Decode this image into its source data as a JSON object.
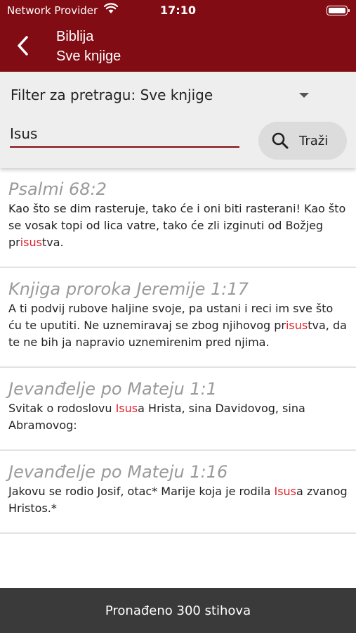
{
  "status_bar": {
    "carrier": "Network Provider",
    "time": "17:10"
  },
  "header": {
    "title": "Biblija",
    "subtitle": "Sve knjige"
  },
  "search": {
    "filter_label": "Filter za pretragu: Sve knjige",
    "query": "Isus",
    "button_label": "Traži"
  },
  "results": [
    {
      "reference": "Psalmi 68:2",
      "pre": "Kao što se dim rasteruje, tako će i oni biti rasterani! Kao što se vosak topi od lica vatre, tako će zli izginuti od Božjeg pr",
      "match": "isus",
      "post": "tva."
    },
    {
      "reference": "Knjiga proroka Jeremije 1:17",
      "pre": "A ti podvij rubove haljine svoje, pa ustani i reci im sve što ću te uputiti. Ne uznemiravaj se zbog njihovog pr",
      "match": "isus",
      "post": "tva, da te ne bih ja napravio uznemirenim pred njima."
    },
    {
      "reference": "Jevanđelje po Mateju 1:1",
      "pre": "Svitak o rodoslovu ",
      "match": "Isus",
      "post": "a Hrista, sina Davidovog, sina Abramovog:"
    },
    {
      "reference": "Jevanđelje po Mateju 1:16",
      "pre": "Jakovu se rodio Josif, otac* Marije koja je rodila ",
      "match": "Isus",
      "post": "a zvanog Hristos.*"
    }
  ],
  "footer": {
    "count_text": "Pronađeno 300 stihova"
  },
  "colors": {
    "brand": "#820c14",
    "highlight": "#e0202a",
    "footer_bg": "#3a3a3a"
  }
}
